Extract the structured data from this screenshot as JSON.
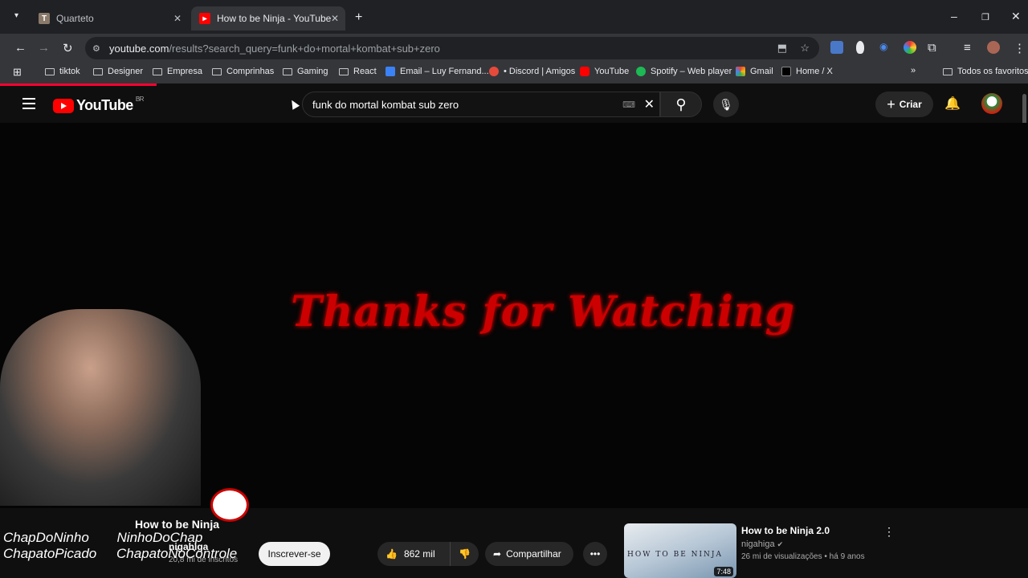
{
  "browser": {
    "tabs": [
      {
        "label": "Quarteto",
        "favicon_letter": "T"
      },
      {
        "label": "How to be Ninja - YouTube"
      }
    ],
    "url_host": "youtube.com",
    "url_path": "/results?search_query=funk+do+mortal+kombat+sub+zero",
    "bookmarks": [
      "tiktok",
      "Designer",
      "Empresa",
      "Comprinhas",
      "Gaming",
      "React",
      "Email – Luy Fernand...",
      "• Discord | Amigos",
      "YouTube",
      "Spotify – Web player",
      "Gmail",
      "Home / X"
    ],
    "all_bookmarks": "Todos os favoritos"
  },
  "youtube": {
    "logo_text": "YouTube",
    "region": "BR",
    "search_value": "funk do mortal kombat sub zero",
    "create_label": "Criar"
  },
  "player": {
    "overlay_text": "Thanks for Watching"
  },
  "streamer_overlay": {
    "socials_row1": [
      "ChapDoNinho",
      "NinhoDoChap"
    ],
    "socials_row2": [
      "ChapatoPicado",
      "ChapatoNoControle"
    ]
  },
  "video": {
    "title": "How to be Ninja",
    "channel": "nigahiga",
    "subscribers": "20,8 mi de inscritos",
    "subscribe_label": "Inscrever-se",
    "likes": "862 mil",
    "share_label": "Compartilhar"
  },
  "recommendation": {
    "title": "How to be Ninja 2.0",
    "channel": "nigahiga",
    "meta": "26 mi de visualizações • há 9 anos",
    "thumb_text": "HOW TO BE NINJA",
    "duration": "7:48"
  }
}
